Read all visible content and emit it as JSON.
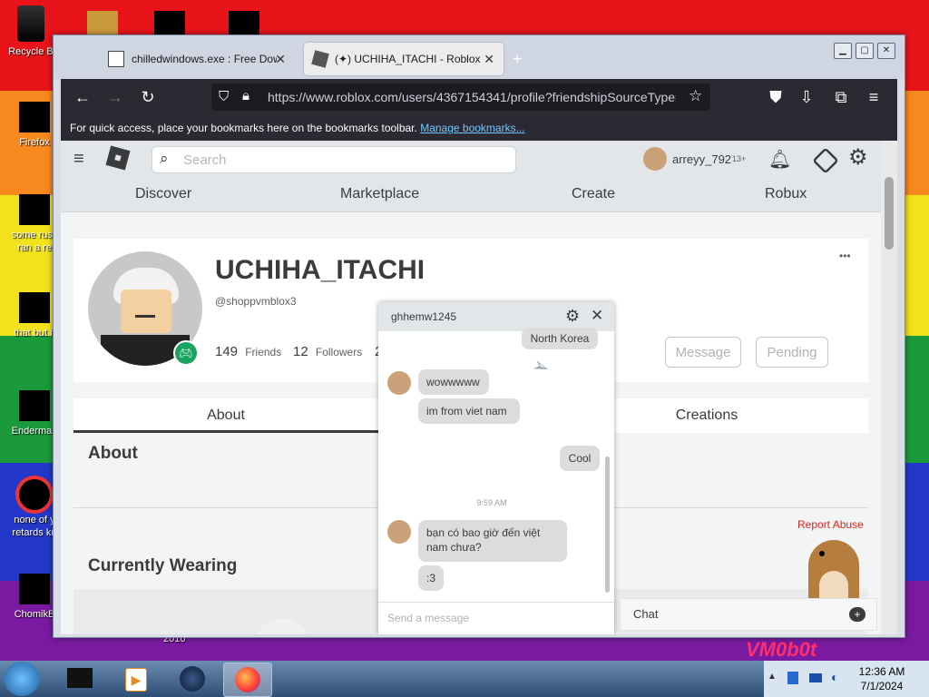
{
  "desktop": {
    "icons": [
      {
        "label": "Recycle B"
      },
      {
        "label": "Firefox"
      },
      {
        "label": "some russ ran a re"
      },
      {
        "label": "that but it"
      },
      {
        "label": "Enderman"
      },
      {
        "label": "none of y retards kn"
      },
      {
        "label": "ChomikB"
      }
    ],
    "bottom_labels": {
      "left": "2016",
      "right": "VM0b0t"
    }
  },
  "browser": {
    "tabs": [
      {
        "title": "chilledwindows.exe : Free Down",
        "active": false
      },
      {
        "title": "(✦) UCHIHA_ITACHI - Roblox",
        "active": true
      }
    ],
    "url": "https://www.roblox.com/users/4367154341/profile?friendshipSourceType=",
    "bookmarks_text": "For quick access, place your bookmarks here on the bookmarks toolbar.",
    "bookmarks_link": "Manage bookmarks..."
  },
  "roblox": {
    "search_placeholder": "Search",
    "user": {
      "name": "arreyy_792",
      "badge": "13+"
    },
    "nav": [
      "Discover",
      "Marketplace",
      "Create",
      "Robux"
    ],
    "profile": {
      "display_name": "UCHIHA_ITACHI",
      "username": "@shoppvmblox3",
      "friends_count": "149",
      "friends_label": "Friends",
      "followers_count": "12",
      "followers_label": "Followers",
      "following_partial": "2",
      "message_button": "Message",
      "pending_button": "Pending",
      "more_menu": "•••"
    },
    "tabs": [
      "About",
      "Creations"
    ],
    "about_title": "About",
    "wearing_title": "Currently Wearing",
    "report_abuse": "Report Abuse"
  },
  "chat": {
    "partner": "ghhemw1245",
    "messages": [
      {
        "text": "North Korea",
        "side": "right"
      },
      {
        "text": "wowwwww",
        "side": "left"
      },
      {
        "text": "im from viet nam",
        "side": "left"
      },
      {
        "text": "Cool",
        "side": "right"
      },
      {
        "text": "bạn có bao giờ đến việt nam chưa?",
        "side": "left"
      },
      {
        "text": ":3",
        "side": "left"
      }
    ],
    "timestamp": "9:59 AM",
    "input_placeholder": "Send a message",
    "chatbar_label": "Chat"
  },
  "taskbar": {
    "time": "12:36 AM",
    "date": "7/1/2024"
  },
  "colors": {
    "navbar": "#2b2a33",
    "link": "#6fc8ff",
    "report": "#e2231a"
  }
}
